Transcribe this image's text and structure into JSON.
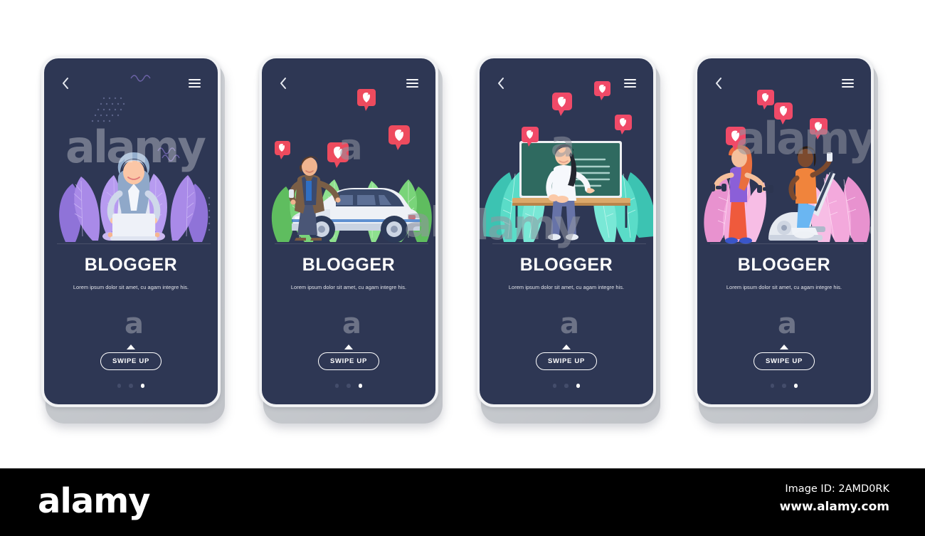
{
  "footer": {
    "logo": "alamy",
    "image_id": "Image ID: 2AMD0RK",
    "url": "www.alamy.com",
    "background": "#000000"
  },
  "watermarks": {
    "word": "alamy",
    "letter": "a"
  },
  "theme": {
    "screen_background": "#2e3754",
    "frame": "#c7cace",
    "title_color": "#ffffff",
    "subtitle_color": "#e4e6ec",
    "accent_heart": "#ee4b5e",
    "dot_active": "#ffffff",
    "dot_inactive": "#444d6b"
  },
  "screens": [
    {
      "id": "screen-blogger-laptop",
      "title": "BLOGGER",
      "subtitle": "Lorem ipsum dolor sit amet, cu agam integre his.",
      "swipe_label": "SWIPE UP",
      "back_icon": "chevron-left-icon",
      "menu_icon": "hamburger-menu-icon",
      "illustration": "woman-with-laptop-sitting",
      "leaf_color": "#9b7fe0",
      "leaf_color_2": "#8f73d8",
      "dots": [
        false,
        false,
        true
      ]
    },
    {
      "id": "screen-blogger-car",
      "title": "BLOGGER",
      "subtitle": "Lorem ipsum dolor sit amet, cu agam integre his.",
      "swipe_label": "SWIPE UP",
      "back_icon": "chevron-left-icon",
      "menu_icon": "hamburger-menu-icon",
      "illustration": "man-with-electric-car",
      "leaf_color": "#6dcb6d",
      "leaf_color_2": "#8ed98e",
      "dots": [
        false,
        false,
        true
      ]
    },
    {
      "id": "screen-blogger-teacher",
      "title": "BLOGGER",
      "subtitle": "Lorem ipsum dolor sit amet, cu agam integre his.",
      "swipe_label": "SWIPE UP",
      "back_icon": "chevron-left-icon",
      "menu_icon": "hamburger-menu-icon",
      "illustration": "woman-teacher-at-blackboard",
      "leaf_color": "#4ed6c4",
      "leaf_color_2": "#3cc3b2",
      "dots": [
        false,
        false,
        true
      ]
    },
    {
      "id": "screen-blogger-gym",
      "title": "BLOGGER",
      "subtitle": "Lorem ipsum dolor sit amet, cu agam integre his.",
      "swipe_label": "SWIPE UP",
      "back_icon": "chevron-left-icon",
      "menu_icon": "hamburger-menu-icon",
      "illustration": "two-women-exercising-gym",
      "leaf_color": "#f0a8dc",
      "leaf_color_2": "#e892cf",
      "dots": [
        false,
        false,
        true
      ]
    }
  ]
}
